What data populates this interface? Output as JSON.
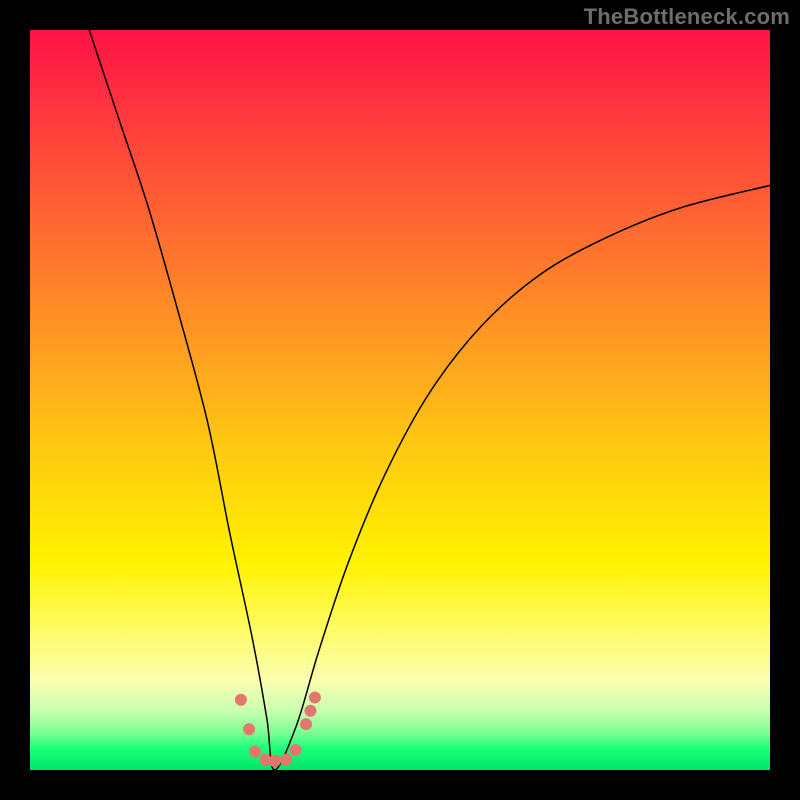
{
  "watermark": "TheBottleneck.com",
  "chart_data": {
    "type": "line",
    "title": "",
    "xlabel": "",
    "ylabel": "",
    "xlim": [
      0,
      100
    ],
    "ylim": [
      0,
      100
    ],
    "grid": false,
    "legend": false,
    "note": "Axes have no tick labels; values are estimated relative percentages over the 740×740 plot area (0=left/bottom, 100=right/top). The curve is a V-shape with minimum near x≈33, y≈0 and rises steeply on both sides. Scatter points cluster at the bottom of the V.",
    "series": [
      {
        "name": "bottleneck-curve",
        "type": "line",
        "x": [
          8,
          12,
          16,
          20,
          24,
          27,
          30,
          32,
          33,
          36,
          39,
          43,
          48,
          54,
          61,
          69,
          78,
          88,
          100
        ],
        "y": [
          100,
          88,
          76,
          62,
          47,
          32,
          18,
          7,
          0,
          6,
          16,
          28,
          40,
          51,
          60,
          67,
          72,
          76,
          79
        ]
      },
      {
        "name": "measured-points",
        "type": "scatter",
        "points": [
          {
            "x": 28.5,
            "y": 9.5
          },
          {
            "x": 29.6,
            "y": 5.5
          },
          {
            "x": 30.4,
            "y": 2.5
          },
          {
            "x": 31.8,
            "y": 1.4
          },
          {
            "x": 33.1,
            "y": 1.2
          },
          {
            "x": 34.6,
            "y": 1.4
          },
          {
            "x": 35.9,
            "y": 2.7
          },
          {
            "x": 37.3,
            "y": 6.2
          },
          {
            "x": 37.9,
            "y": 8.0
          },
          {
            "x": 38.5,
            "y": 9.8
          }
        ]
      }
    ]
  }
}
